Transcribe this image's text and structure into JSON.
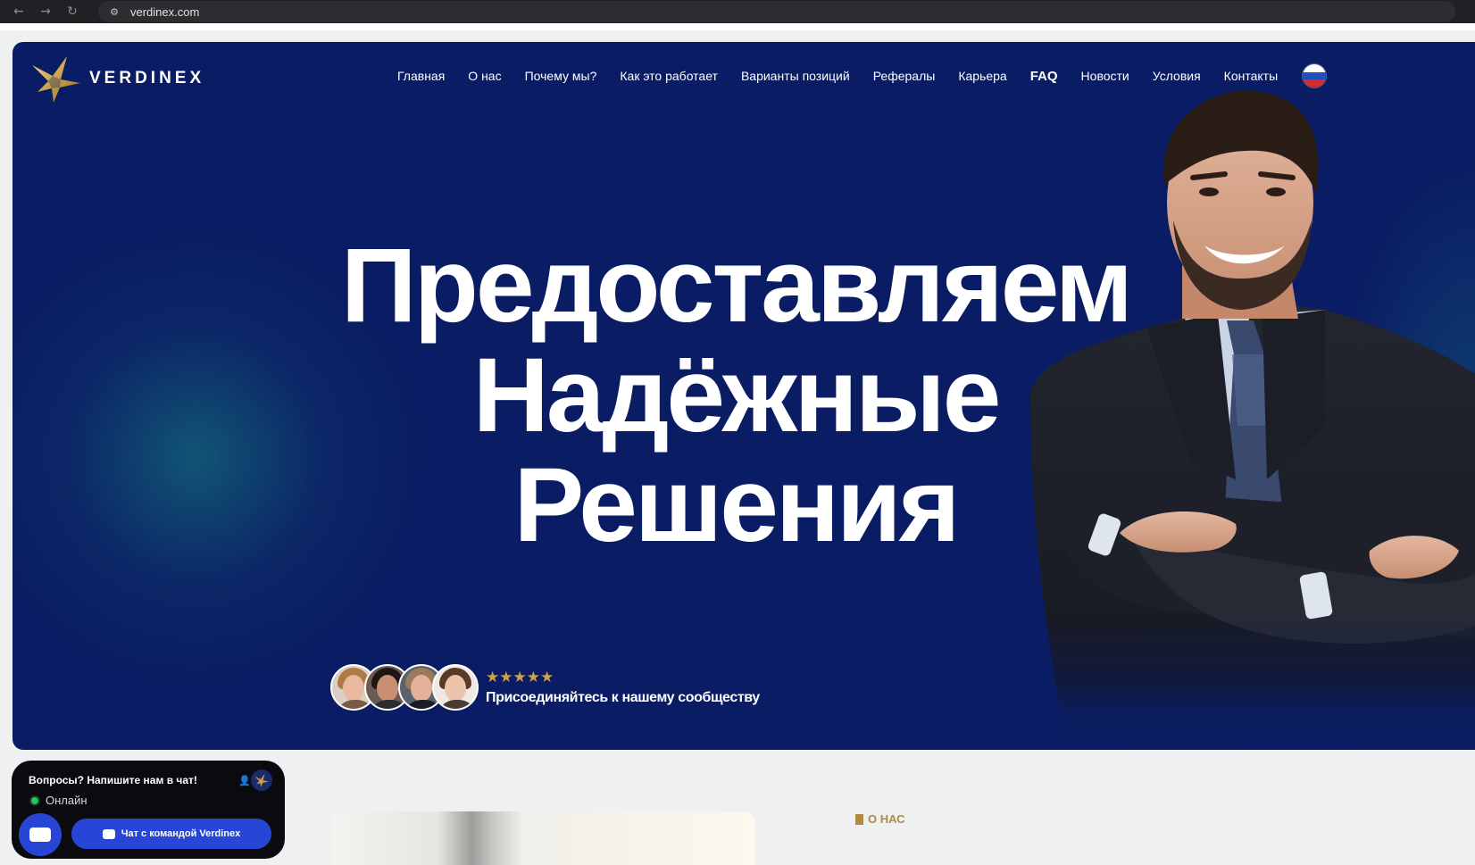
{
  "browser": {
    "back_icon": "arrow-left-icon",
    "forward_icon": "arrow-right-icon",
    "reload_icon": "reload-icon",
    "url": "verdinex.com"
  },
  "header": {
    "logo_text": "VERDINEX",
    "nav": [
      "Главная",
      "О нас",
      "Почему мы?",
      "Как это работает",
      "Варианты позиций",
      "Рефералы",
      "Карьера",
      "FAQ",
      "Новости",
      "Условия",
      "Контакты"
    ],
    "language_flag": "russian-flag-icon"
  },
  "hero": {
    "title_line_1": "Предоставляем",
    "title_line_2": "Надёжные",
    "title_line_3": "Решения",
    "rating_stars": "★★★★★",
    "community_text": "Присоединяйтесь к нашему сообществу"
  },
  "about": {
    "tag": "О НАС"
  },
  "chat": {
    "title": "Вопросы? Напишите нам в чат!",
    "status": "Онлайн",
    "team_button": "Чат с командой Verdinex"
  },
  "colors": {
    "hero_bg": "#0a1c63",
    "accent_gold": "#c9a24a",
    "chat_blue": "#2746d6",
    "online_green": "#29c45a"
  }
}
